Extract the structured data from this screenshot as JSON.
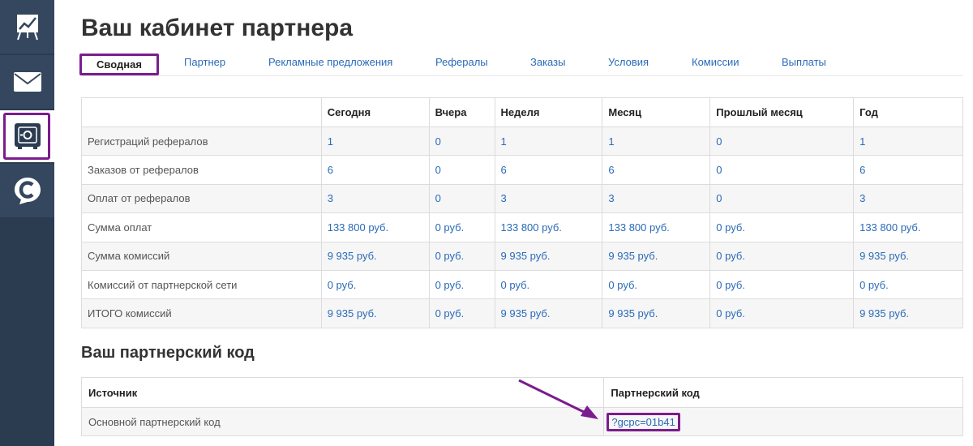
{
  "sidebar": {
    "items": [
      {
        "name": "stats-chart-icon"
      },
      {
        "name": "mail-icon"
      },
      {
        "name": "safe-icon"
      },
      {
        "name": "chat-c-icon"
      }
    ],
    "accent": "#7b1c8e",
    "background": "#2b3c51"
  },
  "page": {
    "title": "Ваш кабинет партнера"
  },
  "tabs": [
    {
      "label": "Сводная",
      "active": true
    },
    {
      "label": "Партнер"
    },
    {
      "label": "Рекламные предложения"
    },
    {
      "label": "Рефералы"
    },
    {
      "label": "Заказы"
    },
    {
      "label": "Условия"
    },
    {
      "label": "Комиссии"
    },
    {
      "label": "Выплаты"
    }
  ],
  "stats": {
    "headers": [
      "",
      "Сегодня",
      "Вчера",
      "Неделя",
      "Месяц",
      "Прошлый месяц",
      "Год"
    ],
    "rows": [
      {
        "label": "Регистраций рефералов",
        "values": [
          "1",
          "0",
          "1",
          "1",
          "0",
          "1"
        ]
      },
      {
        "label": "Заказов от рефералов",
        "values": [
          "6",
          "0",
          "6",
          "6",
          "0",
          "6"
        ]
      },
      {
        "label": "Оплат от рефералов",
        "values": [
          "3",
          "0",
          "3",
          "3",
          "0",
          "3"
        ]
      },
      {
        "label": "Сумма оплат",
        "values": [
          "133 800 руб.",
          "0 руб.",
          "133 800 руб.",
          "133 800 руб.",
          "0 руб.",
          "133 800 руб."
        ]
      },
      {
        "label": "Сумма комиссий",
        "values": [
          "9 935 руб.",
          "0 руб.",
          "9 935 руб.",
          "9 935 руб.",
          "0 руб.",
          "9 935 руб."
        ]
      },
      {
        "label": "Комиссий от партнерской сети",
        "values": [
          "0 руб.",
          "0 руб.",
          "0 руб.",
          "0 руб.",
          "0 руб.",
          "0 руб."
        ]
      },
      {
        "label": "ИТОГО комиссий",
        "values": [
          "9 935 руб.",
          "0 руб.",
          "9 935 руб.",
          "9 935 руб.",
          "0 руб.",
          "9 935 руб."
        ]
      }
    ]
  },
  "partner_code": {
    "title": "Ваш партнерский код",
    "headers": [
      "Источник",
      "Партнерский код"
    ],
    "rows": [
      {
        "source": "Основной партнерский код",
        "code": "?gcpc=01b41"
      }
    ]
  },
  "colors": {
    "link": "#2a6ab8",
    "highlight": "#7b1c8e"
  }
}
